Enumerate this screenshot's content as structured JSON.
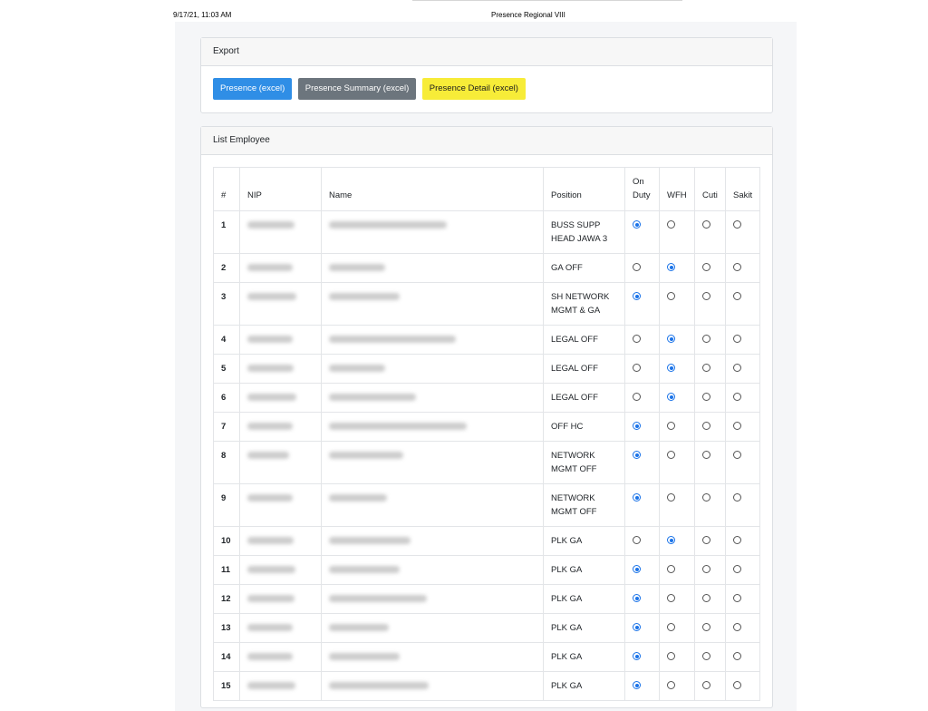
{
  "print_header": {
    "timestamp": "9/17/21, 11:03 AM",
    "title": "Presence Regional VIII"
  },
  "export": {
    "title": "Export",
    "buttons": {
      "presence": "Presence (excel)",
      "summary": "Presence Summary (excel)",
      "detail": "Presence Detail (excel)"
    }
  },
  "employees": {
    "title": "List Employee",
    "columns": {
      "num": "#",
      "nip": "NIP",
      "name": "Name",
      "position": "Position",
      "on_duty": "On Duty",
      "wfh": "WFH",
      "cuti": "Cuti",
      "sakit": "Sakit"
    },
    "rows": [
      {
        "num": "1",
        "position": "BUSS SUPP HEAD JAWA 3",
        "status": "on_duty"
      },
      {
        "num": "2",
        "position": "GA OFF",
        "status": "wfh"
      },
      {
        "num": "3",
        "position": "SH NETWORK MGMT & GA",
        "status": "on_duty"
      },
      {
        "num": "4",
        "position": "LEGAL OFF",
        "status": "wfh"
      },
      {
        "num": "5",
        "position": "LEGAL OFF",
        "status": "wfh"
      },
      {
        "num": "6",
        "position": "LEGAL OFF",
        "status": "wfh"
      },
      {
        "num": "7",
        "position": "OFF HC",
        "status": "on_duty"
      },
      {
        "num": "8",
        "position": "NETWORK MGMT OFF",
        "status": "on_duty"
      },
      {
        "num": "9",
        "position": "NETWORK MGMT OFF",
        "status": "on_duty"
      },
      {
        "num": "10",
        "position": "PLK GA",
        "status": "wfh"
      },
      {
        "num": "11",
        "position": "PLK GA",
        "status": "on_duty"
      },
      {
        "num": "12",
        "position": "PLK GA",
        "status": "on_duty"
      },
      {
        "num": "13",
        "position": "PLK GA",
        "status": "on_duty"
      },
      {
        "num": "14",
        "position": "PLK GA",
        "status": "on_duty"
      },
      {
        "num": "15",
        "position": "PLK GA",
        "status": "on_duty"
      }
    ]
  },
  "colors": {
    "primary": "#2f8ee6",
    "secondary": "#6c757d",
    "warning": "#f7ec38",
    "radio_checked": "#1a73e8"
  }
}
